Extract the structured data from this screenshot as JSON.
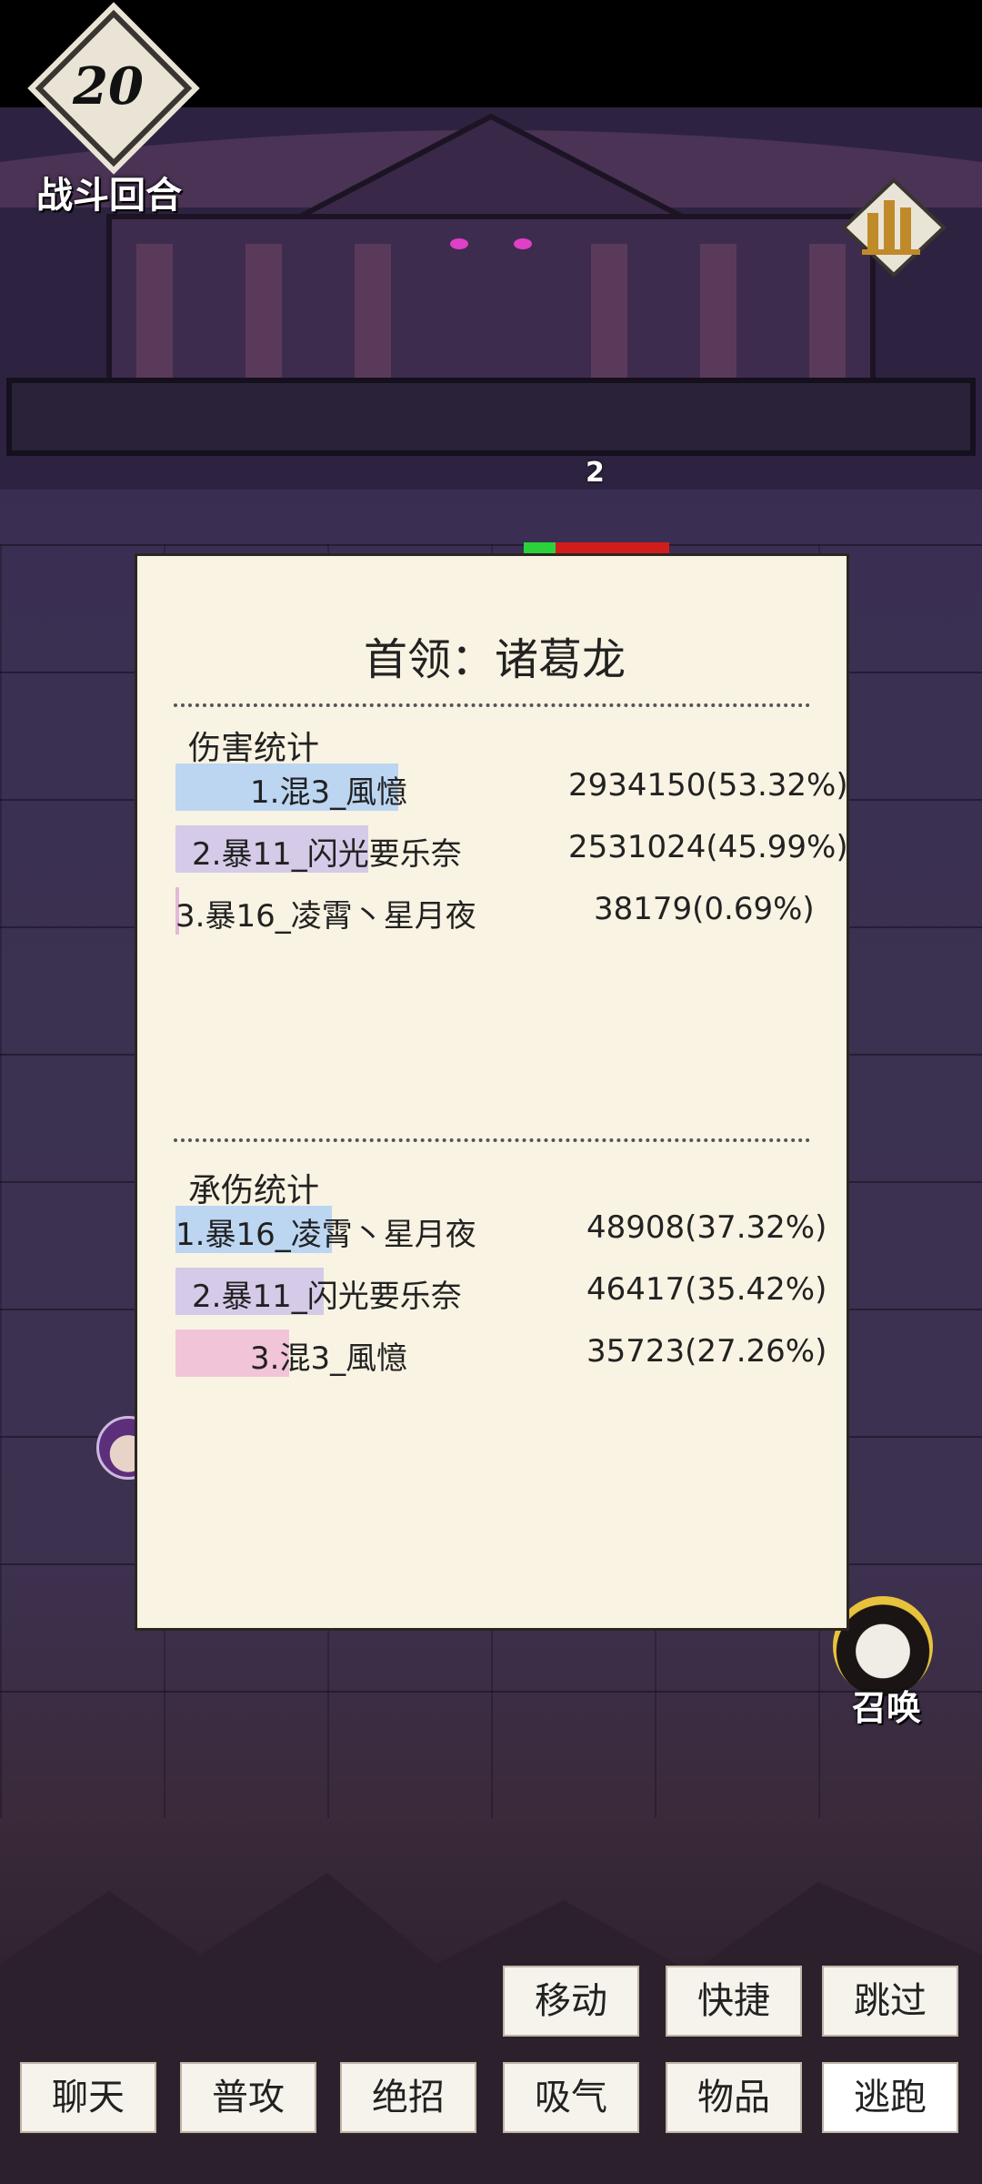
{
  "hud": {
    "round_number": "20",
    "round_label": "战斗回合",
    "floating_number": "2",
    "summon_label": "召唤"
  },
  "panel": {
    "title": "首领：诸葛龙",
    "damage": {
      "title": "伤害统计",
      "rows": [
        {
          "name": "1.混3_風憶",
          "value": "2934150(53.32%)",
          "share": 53.32,
          "color": "#bcd6f2"
        },
        {
          "name": "2.暴11_闪光要乐奈",
          "value": "2531024(45.99%)",
          "share": 45.99,
          "color": "#d5cae8"
        },
        {
          "name": "3.暴16_凌霄丶星月夜",
          "value": "38179(0.69%)",
          "share": 0.69,
          "color": "#e3b8d8"
        }
      ]
    },
    "taken": {
      "title": "承伤统计",
      "rows": [
        {
          "name": "1.暴16_凌霄丶星月夜",
          "value": "48908(37.32%)",
          "share": 37.32,
          "color": "#bcd6f2"
        },
        {
          "name": "2.暴11_闪光要乐奈",
          "value": "46417(35.42%)",
          "share": 35.42,
          "color": "#d5cae8"
        },
        {
          "name": "3.混3_風憶",
          "value": "35723(27.26%)",
          "share": 27.26,
          "color": "#f2c4d8"
        }
      ]
    }
  },
  "actions": {
    "move": "移动",
    "shortcut": "快捷",
    "skip": "跳过",
    "chat": "聊天",
    "attack": "普攻",
    "ultimate": "绝招",
    "absorb": "吸气",
    "items": "物品",
    "flee": "逃跑"
  }
}
